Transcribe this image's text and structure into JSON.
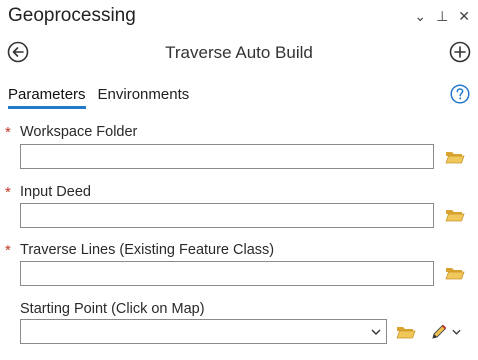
{
  "window": {
    "title": "Geoprocessing",
    "controls": {
      "menu": "⌄",
      "pin": "⊥",
      "close": "✕"
    }
  },
  "tool": {
    "title": "Traverse Auto Build"
  },
  "tabs": [
    {
      "label": "Parameters",
      "active": true
    },
    {
      "label": "Environments",
      "active": false
    }
  ],
  "parameters": [
    {
      "label": "Workspace Folder",
      "required": true,
      "value": ""
    },
    {
      "label": "Input Deed",
      "required": true,
      "value": ""
    },
    {
      "label": "Traverse Lines (Existing Feature Class)",
      "required": true,
      "value": ""
    },
    {
      "label": "Starting Point (Click on Map)",
      "required": false,
      "value": ""
    }
  ],
  "required_marker": "*",
  "colors": {
    "accent": "#2479c9",
    "required": "#c0392b",
    "folder": "#e6b94a"
  }
}
